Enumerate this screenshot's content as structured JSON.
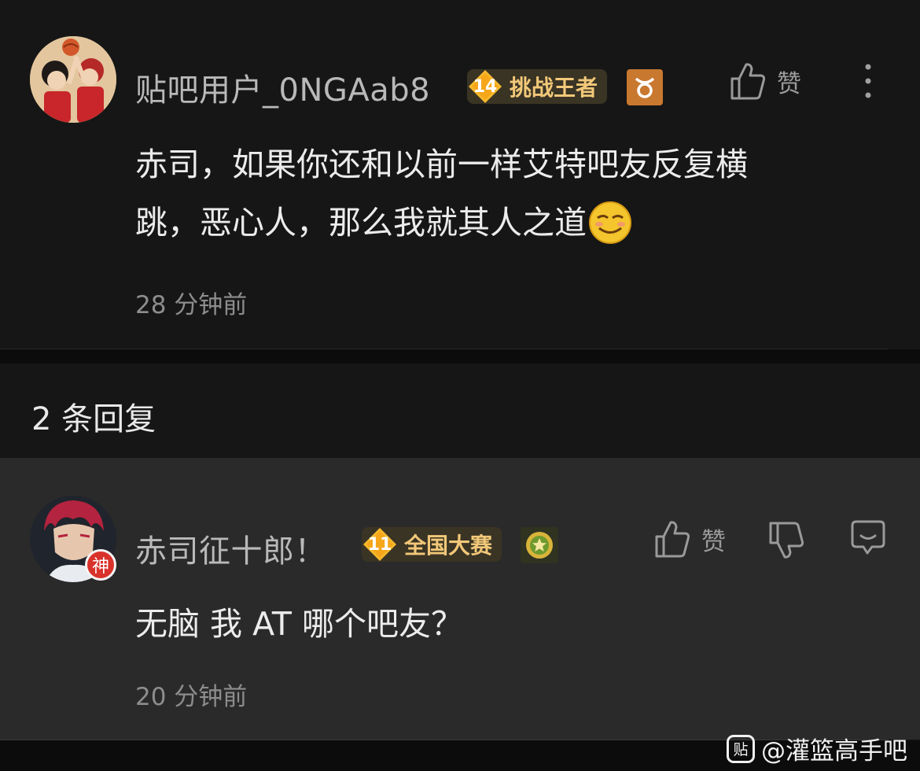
{
  "main_comment": {
    "username": "贴吧用户_0NGAab8",
    "level": "14",
    "level_title": "挑战王者",
    "zodiac_icon": "taurus-icon",
    "like_label": "赞",
    "text_line1": "赤司，如果你还和以前一样艾特吧友反复横",
    "text_line2": "跳，恶心人，那么我就其人之道",
    "emoji": "smirk-emoji",
    "time": "28 分钟前"
  },
  "replies_header": {
    "count_label": "2 条回复"
  },
  "reply": {
    "username": "赤司征十郎！",
    "level": "11",
    "level_title": "全国大赛",
    "avatar_badge": "神",
    "like_label": "赞",
    "text": "无脑 我 AT 哪个吧友？",
    "time": "20 分钟前"
  },
  "watermark": {
    "logo_text": "贴",
    "text": "@灌篮高手吧"
  },
  "colors": {
    "background": "#161616",
    "reply_background": "#2a2a2a",
    "badge_gold": "#f2c879",
    "zodiac_orange": "#c9782f",
    "god_red": "#d9322b"
  }
}
